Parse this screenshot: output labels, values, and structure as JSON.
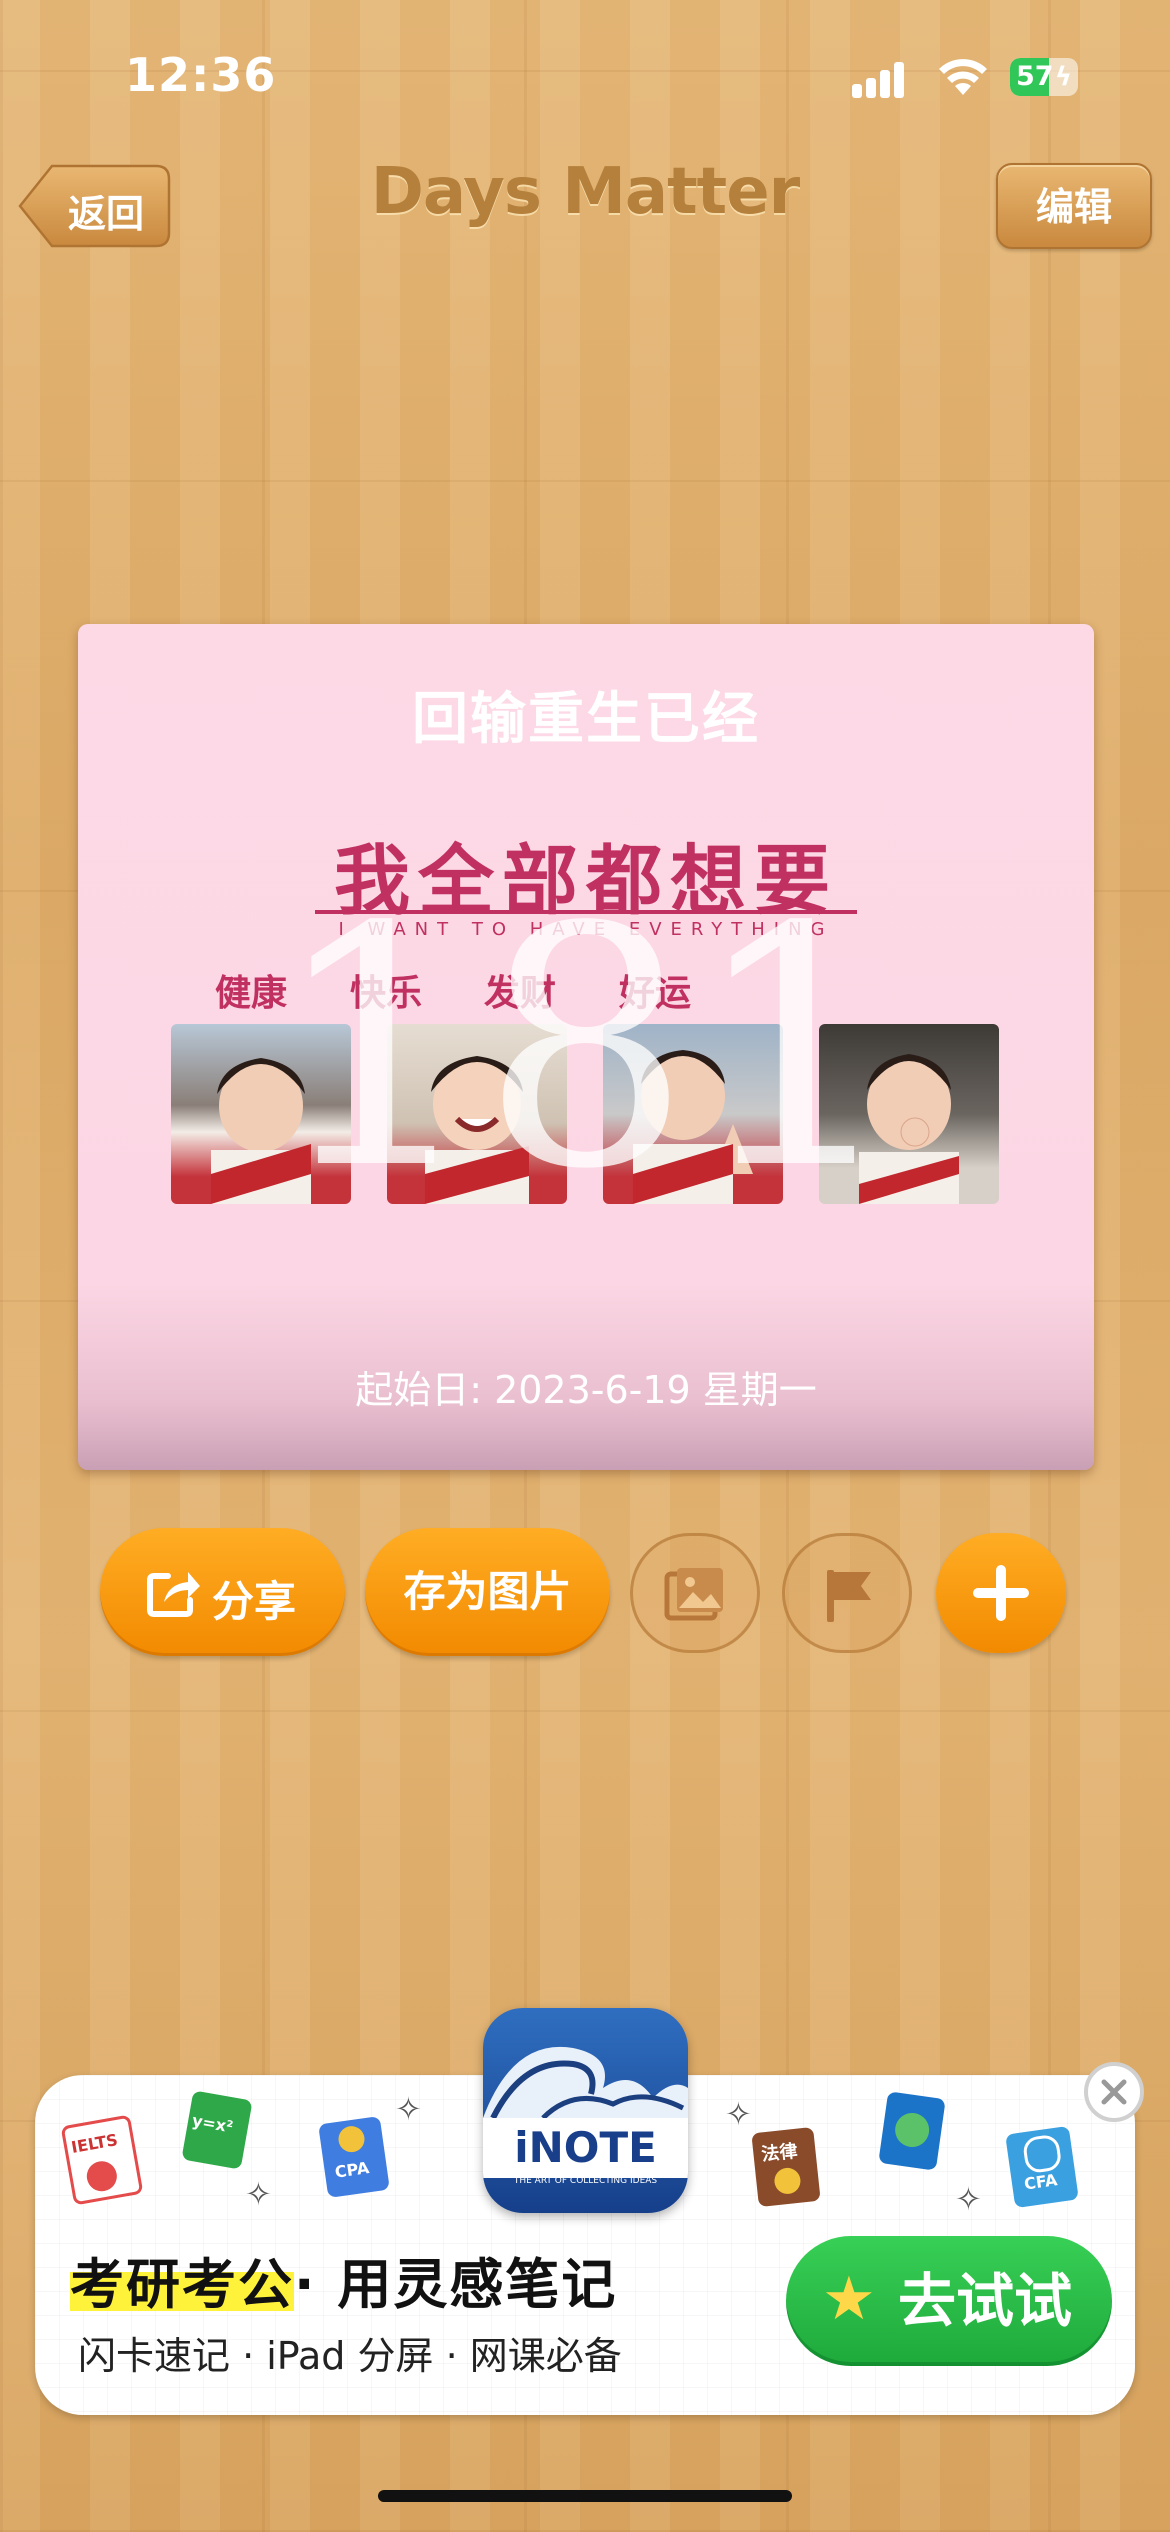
{
  "status": {
    "time": "12:36",
    "battery": "57",
    "battery_level": 0.57
  },
  "nav": {
    "back_label": "返回",
    "title": "Days Matter",
    "edit_label": "编辑"
  },
  "card": {
    "title": "回输重生已经",
    "day_count": "181",
    "start_date": "起始日: 2023-6-19 星期一",
    "image": {
      "slogan": "我全部都想要",
      "sub_slogan": "I WANT TO HAVE EVERYTHING",
      "wishes": [
        "健康",
        "快乐",
        "发财",
        "好运"
      ]
    }
  },
  "toolbar": {
    "share_label": "分享",
    "save_image_label": "存为图片",
    "icons": [
      "share-icon",
      "image-icon",
      "flag-icon",
      "plus-icon"
    ]
  },
  "ad": {
    "brand": "iNOTE",
    "brand_tagline": "THE ART OF COLLECTING IDEAS",
    "headline_highlight": "考研考公",
    "headline_rest": "· 用灵感笔记",
    "subline": "闪卡速记 · iPad 分屏 · 网课必备",
    "cta_label": "去试试",
    "stickers": [
      "IELTS",
      "y=x²",
      "CPA",
      "法律",
      "CFA"
    ]
  },
  "colors": {
    "accent_orange": "#f59a0c",
    "card_pink": "#fcd6e4",
    "slogan_red": "#c03060",
    "cta_green": "#2bbd48"
  }
}
